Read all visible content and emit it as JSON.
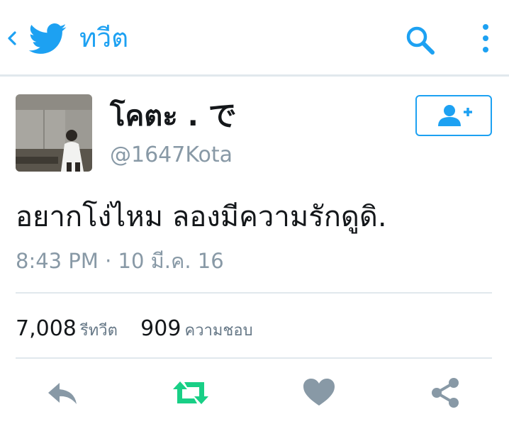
{
  "header": {
    "title": "ทวีต",
    "icons": [
      "chevron-left-icon",
      "twitter-bird-icon",
      "search-icon",
      "more-vertical-icon"
    ]
  },
  "user": {
    "display_name": "โคตะ . で",
    "handle": "@1647Kota"
  },
  "tweet": {
    "text": "อยากโง่ไหม ลองมีความรักดูดิ.",
    "timestamp": "8:43 PM · 10 มี.ค. 16"
  },
  "stats": {
    "retweets_count": "7,008",
    "retweets_label": "รีทวีต",
    "likes_count": "909",
    "likes_label": "ความชอบ"
  },
  "actions": [
    "reply-icon",
    "retweet-icon",
    "like-icon",
    "share-icon"
  ],
  "colors": {
    "accent": "#1da1f2",
    "retweet": "#19cf86",
    "muted": "#8899a6",
    "action_gray": "#8899a6",
    "divider": "#e1e8ed"
  }
}
